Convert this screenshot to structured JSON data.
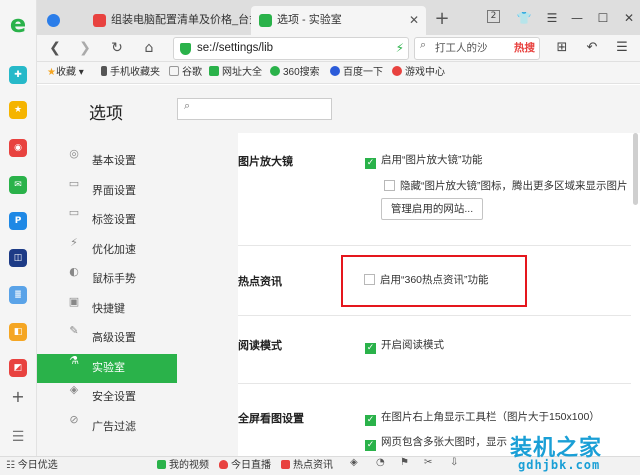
{
  "tabs": [
    {
      "label": "组装电脑配置清单及价格_台式电",
      "favicon_color": "#e8423f"
    },
    {
      "label": "选项 - 实验室",
      "favicon_color": "#2ab24a"
    }
  ],
  "window": {
    "tab_count_badge": "2"
  },
  "address": {
    "url": "se://settings/lib",
    "search_query": "打工人的沙",
    "search_hot": "热搜"
  },
  "bookmarks": [
    {
      "label": "收藏",
      "icon": "star-icon",
      "color": "#f5a623"
    },
    {
      "label": "手机收藏夹",
      "icon": "phone-icon",
      "color": "#555555"
    },
    {
      "label": "谷歌",
      "icon": "page-icon",
      "color": "#999999"
    },
    {
      "label": "网址大全",
      "icon": "home-icon",
      "color": "#2ab24a"
    },
    {
      "label": "360搜索",
      "icon": "360-icon",
      "color": "#2ab24a"
    },
    {
      "label": "百度一下",
      "icon": "baidu-icon",
      "color": "#2b5bd9"
    },
    {
      "label": "游戏中心",
      "icon": "game-icon",
      "color": "#e8423f"
    }
  ],
  "settings": {
    "title": "选项",
    "search_placeholder": "",
    "nav": [
      {
        "label": "基本设置",
        "icon": "gear-icon",
        "glyph": "◎"
      },
      {
        "label": "界面设置",
        "icon": "window-icon",
        "glyph": "▭"
      },
      {
        "label": "标签设置",
        "icon": "tab-icon",
        "glyph": "▭"
      },
      {
        "label": "优化加速",
        "icon": "bolt-icon",
        "glyph": "⚡"
      },
      {
        "label": "鼠标手势",
        "icon": "mouse-icon",
        "glyph": "◐"
      },
      {
        "label": "快捷键",
        "icon": "keyboard-icon",
        "glyph": "▣"
      },
      {
        "label": "高级设置",
        "icon": "wrench-icon",
        "glyph": "✎"
      },
      {
        "label": "实验室",
        "icon": "flask-icon",
        "glyph": "⚗"
      },
      {
        "label": "安全设置",
        "icon": "shield-icon",
        "glyph": "◈"
      },
      {
        "label": "广告过滤",
        "icon": "block-icon",
        "glyph": "⊘"
      }
    ],
    "active_index": 7,
    "sections": {
      "magnifier": {
        "label": "图片放大镜",
        "enable": {
          "label": "启用“图片放大镜”功能",
          "checked": true
        },
        "hide_icon": {
          "label": "隐藏“图片放大镜”图标，腾出更多区域来显示图片",
          "checked": false
        },
        "manage_button": "管理启用的网站..."
      },
      "hotnews": {
        "label": "热点资讯",
        "enable": {
          "label": "启用“360热点资讯”功能",
          "checked": false
        }
      },
      "reading": {
        "label": "阅读模式",
        "enable": {
          "label": "开启阅读模式",
          "checked": true
        }
      },
      "fullscreen": {
        "label": "全屏看图设置",
        "toolbar": {
          "label": "在图片右上角显示工具栏（图片大于150x100）",
          "checked": true
        },
        "multi": {
          "label": "网页包含多张大图时，显示",
          "checked": true
        }
      }
    }
  },
  "statusbar": {
    "left": "今日优选",
    "items": [
      {
        "label": "我的视频",
        "color": "#2ab24a"
      },
      {
        "label": "今日直播",
        "color": "#e8423f"
      },
      {
        "label": "热点资讯",
        "color": "#e8423f"
      }
    ]
  },
  "watermark": {
    "big": "装机之家",
    "small": "gdhjbk.com"
  }
}
